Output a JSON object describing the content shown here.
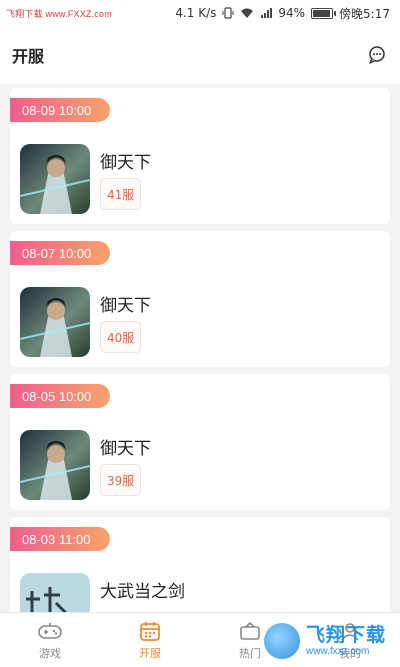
{
  "status_bar": {
    "watermark": "飞翔下载 www.FXXZ.com",
    "net_speed": "4.1 K/s",
    "battery": "94%",
    "time": "傍晚5:17"
  },
  "header": {
    "title": "开服"
  },
  "servers": [
    {
      "time": "08-09 10:00",
      "name": "御天下",
      "server": "41服"
    },
    {
      "time": "08-07 10:00",
      "name": "御天下",
      "server": "40服"
    },
    {
      "time": "08-05 10:00",
      "name": "御天下",
      "server": "39服"
    },
    {
      "time": "08-03 11:00",
      "name": "大武当之剑",
      "server": ""
    }
  ],
  "tabs": [
    {
      "label": "游戏",
      "icon": "gamepad-icon",
      "active": false
    },
    {
      "label": "开服",
      "icon": "calendar-icon",
      "active": true
    },
    {
      "label": "热门",
      "icon": "hot-icon",
      "active": false
    },
    {
      "label": "我的",
      "icon": "user-icon",
      "active": false
    }
  ],
  "watermark_bottom": {
    "cn": "飞翔下载",
    "en": "www.fxxz.com"
  },
  "colors": {
    "accent": "#f08a2e",
    "badge_start": "#f25d8e",
    "badge_end": "#f7a36a",
    "server_tag_text": "#d46b4a"
  }
}
